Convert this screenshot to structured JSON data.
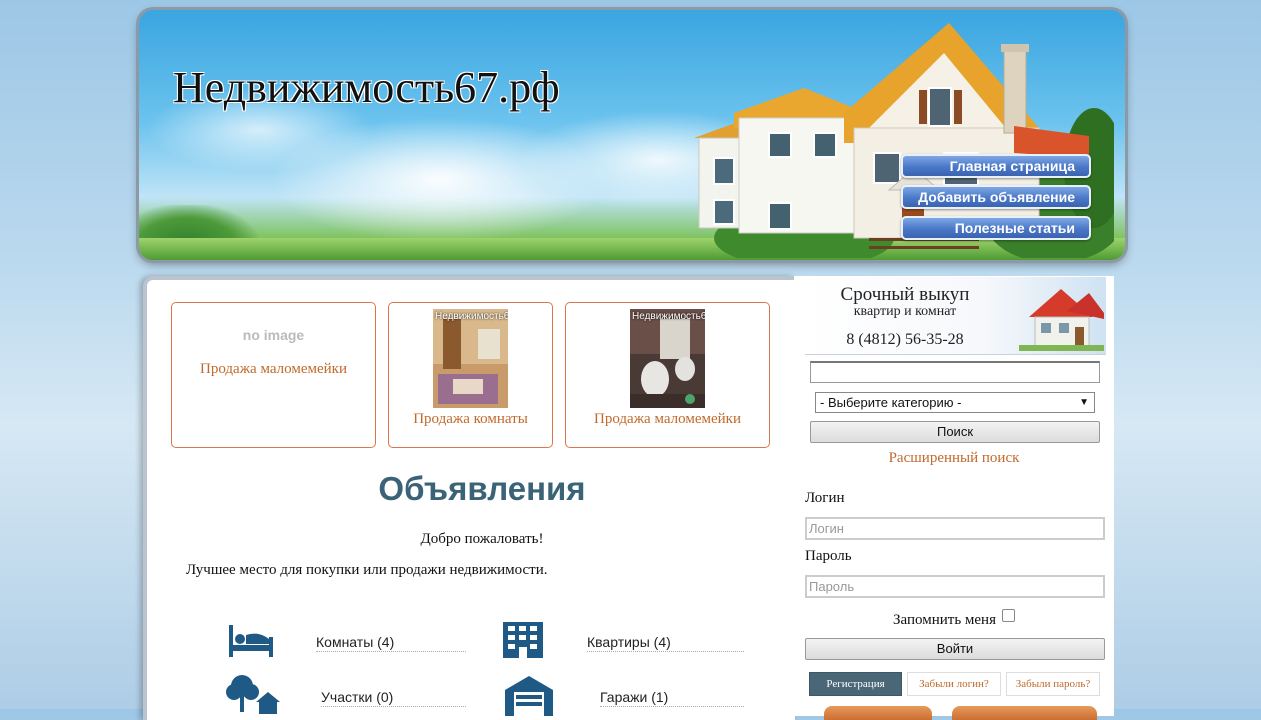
{
  "header": {
    "site_title": "Недвижимость67.рф",
    "nav": [
      {
        "label": "Главная страница"
      },
      {
        "label": "Добавить объявление"
      },
      {
        "label": "Полезные статьи"
      }
    ]
  },
  "featured": [
    {
      "title": "Продажа маломемейки",
      "image": "no image"
    },
    {
      "title": "Продажа комнаты",
      "watermark": "Недвижимость67"
    },
    {
      "title": "Продажа маломемейки",
      "watermark": "Недвижимость67"
    }
  ],
  "main": {
    "heading": "Объявления",
    "welcome": "Добро пожаловать!",
    "tagline": "Лучшее место для покупки или продажи недвижимости.",
    "categories": [
      {
        "label": "Комнаты (4)",
        "icon": "bed-icon"
      },
      {
        "label": "Квартиры (4)",
        "icon": "apartment-building-icon"
      },
      {
        "label": "Участки (0)",
        "icon": "land-plot-icon"
      },
      {
        "label": "Гаражи (1)",
        "icon": "garage-icon"
      }
    ]
  },
  "sidebar": {
    "banner": {
      "line1": "Срочный выкуп",
      "line2": "квартир и комнат",
      "phone": "8 (4812) 56-35-28"
    },
    "search": {
      "value": "",
      "category_selected": "- Выберите категорию -",
      "button": "Поиск",
      "advanced_link": "Расширенный поиск"
    },
    "login": {
      "login_label": "Логин",
      "login_placeholder": "Логин",
      "password_label": "Пароль",
      "password_placeholder": "Пароль",
      "remember_label": "Запомнить меня",
      "submit": "Войти",
      "register": "Регистрация",
      "forgot_login": "Забыли логин?",
      "forgot_password": "Забыли пароль?"
    }
  },
  "colors": {
    "accent_link": "#c06a2c",
    "heading": "#3b6377",
    "nav_button": "#4a78c8",
    "category_icon": "#1f5a86",
    "register_button": "#4a6778"
  }
}
